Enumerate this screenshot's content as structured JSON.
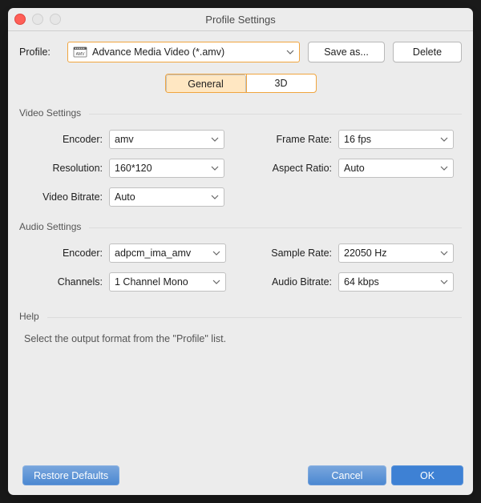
{
  "window": {
    "title": "Profile Settings"
  },
  "toolbar": {
    "profile_label": "Profile:",
    "profile_value": "Advance Media Video (*.amv)",
    "saveas_label": "Save as...",
    "delete_label": "Delete"
  },
  "tabs": {
    "general": "General",
    "threeD": "3D",
    "selected": "general"
  },
  "video": {
    "group_title": "Video Settings",
    "encoder_label": "Encoder:",
    "encoder_value": "amv",
    "framerate_label": "Frame Rate:",
    "framerate_value": "16 fps",
    "resolution_label": "Resolution:",
    "resolution_value": "160*120",
    "aspect_label": "Aspect Ratio:",
    "aspect_value": "Auto",
    "vbitrate_label": "Video Bitrate:",
    "vbitrate_value": "Auto"
  },
  "audio": {
    "group_title": "Audio Settings",
    "encoder_label": "Encoder:",
    "encoder_value": "adpcm_ima_amv",
    "samplerate_label": "Sample Rate:",
    "samplerate_value": "22050 Hz",
    "channels_label": "Channels:",
    "channels_value": "1 Channel Mono",
    "abitrate_label": "Audio Bitrate:",
    "abitrate_value": "64 kbps"
  },
  "help": {
    "group_title": "Help",
    "text": "Select the output format from the \"Profile\" list."
  },
  "footer": {
    "restore": "Restore Defaults",
    "cancel": "Cancel",
    "ok": "OK"
  },
  "colors": {
    "accent": "#f0a53f",
    "primary": "#3e81d4"
  }
}
